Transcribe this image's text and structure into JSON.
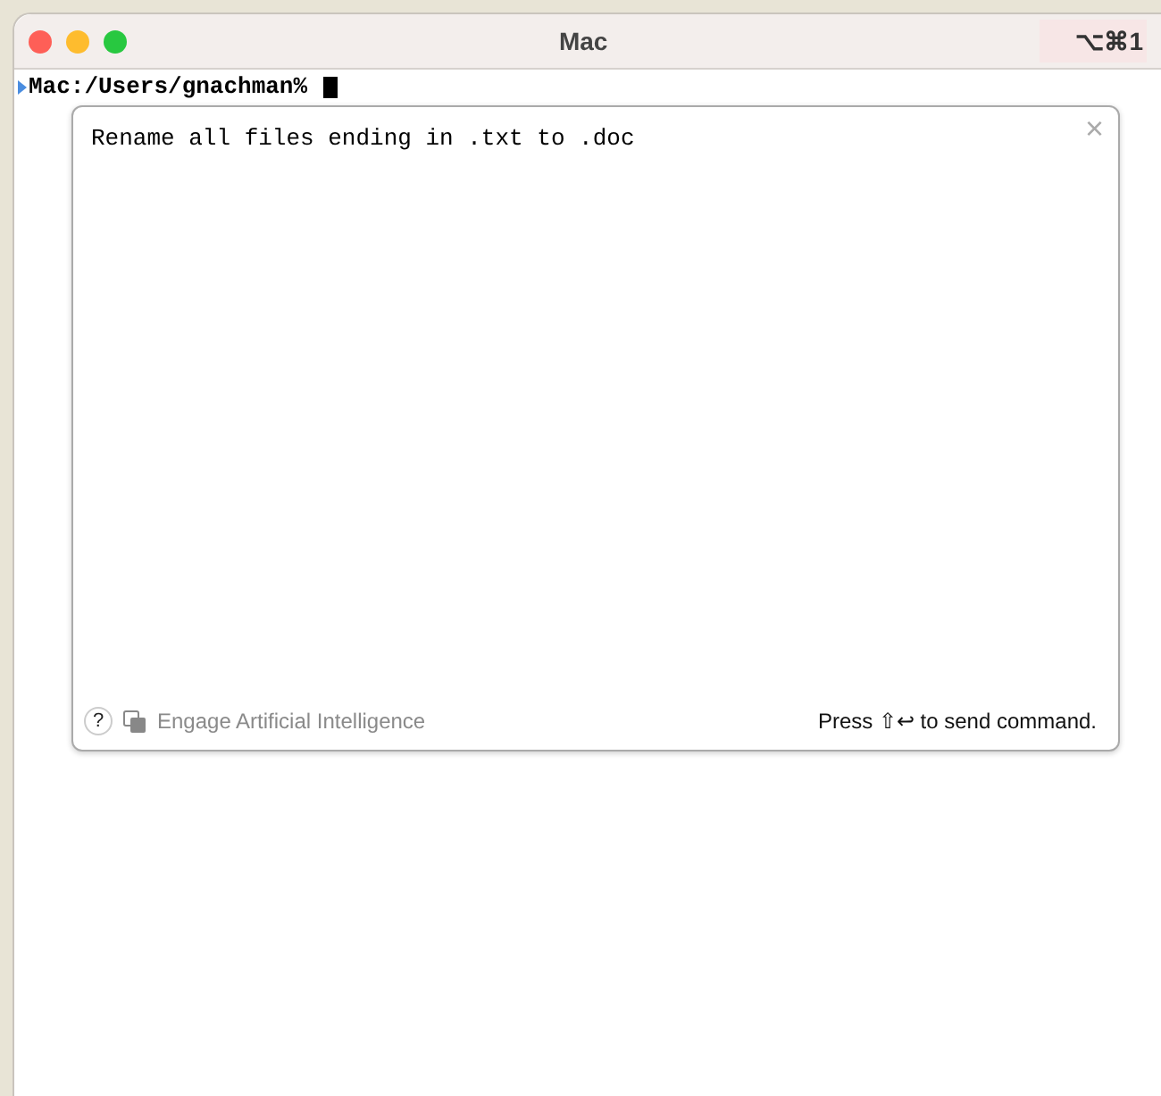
{
  "window": {
    "title": "Mac",
    "shortcut": "⌥⌘1"
  },
  "terminal": {
    "prompt": "Mac:/Users/gnachman%"
  },
  "composer": {
    "value": "Rename all files ending in .txt to .doc",
    "help": "?",
    "ai_toggle": {
      "label": "Engage Artificial Intelligence",
      "enabled": false
    },
    "hint": "Press ⇧↩ to send command.",
    "close": "×"
  }
}
